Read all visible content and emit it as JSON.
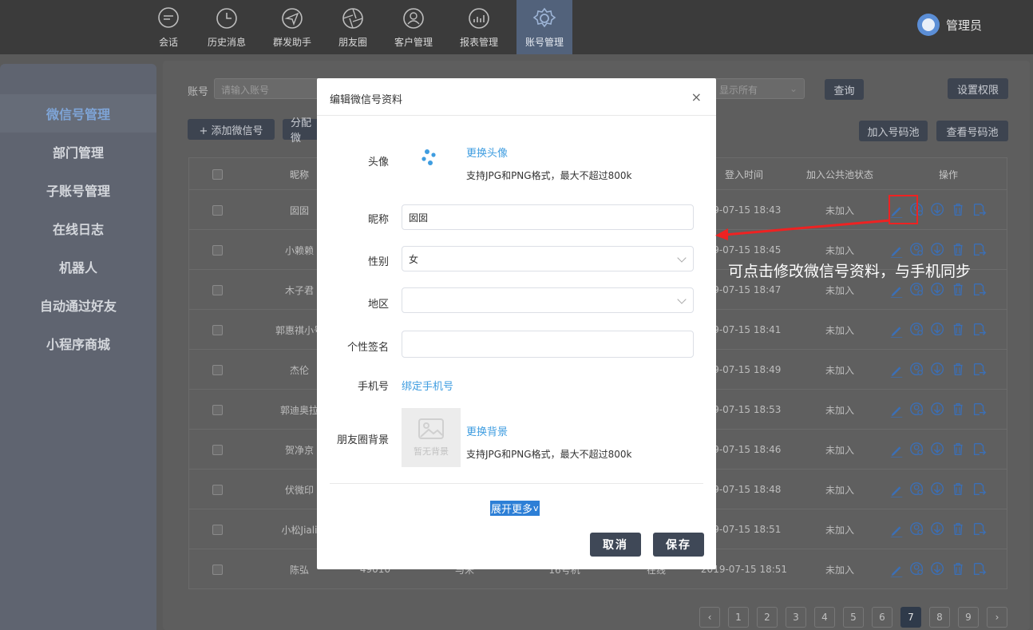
{
  "nav": {
    "items": [
      {
        "label": "会话",
        "icon": "chat-icon"
      },
      {
        "label": "历史消息",
        "icon": "clock-icon"
      },
      {
        "label": "群发助手",
        "icon": "paper-plane-icon"
      },
      {
        "label": "朋友圈",
        "icon": "aperture-icon"
      },
      {
        "label": "客户管理",
        "icon": "customer-icon"
      },
      {
        "label": "报表管理",
        "icon": "chart-icon"
      },
      {
        "label": "账号管理",
        "icon": "gear-icon"
      }
    ],
    "active": "账号管理",
    "user": "管理员"
  },
  "sidebar": {
    "items": [
      "微信号管理",
      "部门管理",
      "子账号管理",
      "在线日志",
      "机器人",
      "自动通过好友",
      "小程序商城"
    ],
    "active": "微信号管理"
  },
  "toolbar": {
    "account_label": "账号",
    "account_placeholder": "请输入账号",
    "filter_value": "显示所有",
    "query": "查询",
    "permissions": "设置权限",
    "add_wechat": "+ 添加微信号",
    "assign": "分配微",
    "join_pool": "加入号码池",
    "view_pool": "查看号码池"
  },
  "table": {
    "headers": {
      "nickname": "昵称",
      "login_time": "登入时间",
      "pool_status": "加入公共池状态",
      "actions": "操作"
    },
    "rows": [
      {
        "nickname": "囡囡",
        "time": "19-07-15 18:43",
        "status": "未加入"
      },
      {
        "nickname": "小赖赖",
        "time": "19-07-15 18:45",
        "status": "未加入"
      },
      {
        "nickname": "木子君",
        "time": "19-07-15 18:47",
        "status": "未加入"
      },
      {
        "nickname": "郭惠祺小号",
        "time": "19-07-15 18:41",
        "status": "未加入"
      },
      {
        "nickname": "杰伦",
        "time": "19-07-15 18:49",
        "status": "未加入"
      },
      {
        "nickname": "郭迪奥拉",
        "time": "19-07-15 18:53",
        "status": "未加入"
      },
      {
        "nickname": "贺净京",
        "time": "19-07-15 18:46",
        "status": "未加入"
      },
      {
        "nickname": "伏微印",
        "time": "19-07-15 18:48",
        "status": "未加入"
      },
      {
        "nickname": "小松Jiali",
        "time": "19-07-15 18:51",
        "status": "未加入"
      },
      {
        "nickname": "陈弘",
        "time": "2019-07-15 18:51",
        "status": "未加入",
        "extra": [
          "49010",
          "与米",
          "16号机",
          "在线"
        ]
      }
    ]
  },
  "pagination": {
    "prev": "‹",
    "next": "›",
    "pages": [
      "1",
      "2",
      "3",
      "4",
      "5",
      "6",
      "7",
      "8",
      "9"
    ],
    "active": "7"
  },
  "modal": {
    "title": "编辑微信号资料",
    "close": "×",
    "avatar_label": "头像",
    "change_avatar": "更换头像",
    "avatar_hint": "支持JPG和PNG格式，最大不超过800k",
    "nickname_label": "昵称",
    "nickname_value": "囡囡",
    "gender_label": "性别",
    "gender_value": "女",
    "region_label": "地区",
    "region_value": "",
    "signature_label": "个性签名",
    "signature_value": "",
    "phone_label": "手机号",
    "bind_phone": "绑定手机号",
    "moments_bg_label": "朋友圈背景",
    "no_bg": "暂无背景",
    "change_bg": "更换背景",
    "bg_hint": "支持JPG和PNG格式，最大不超过800k",
    "expand_more": "展开更多",
    "cancel": "取消",
    "save": "保存"
  },
  "annotation": {
    "text": "可点击修改微信号资料，与手机同步",
    "color": "#ee2222"
  }
}
